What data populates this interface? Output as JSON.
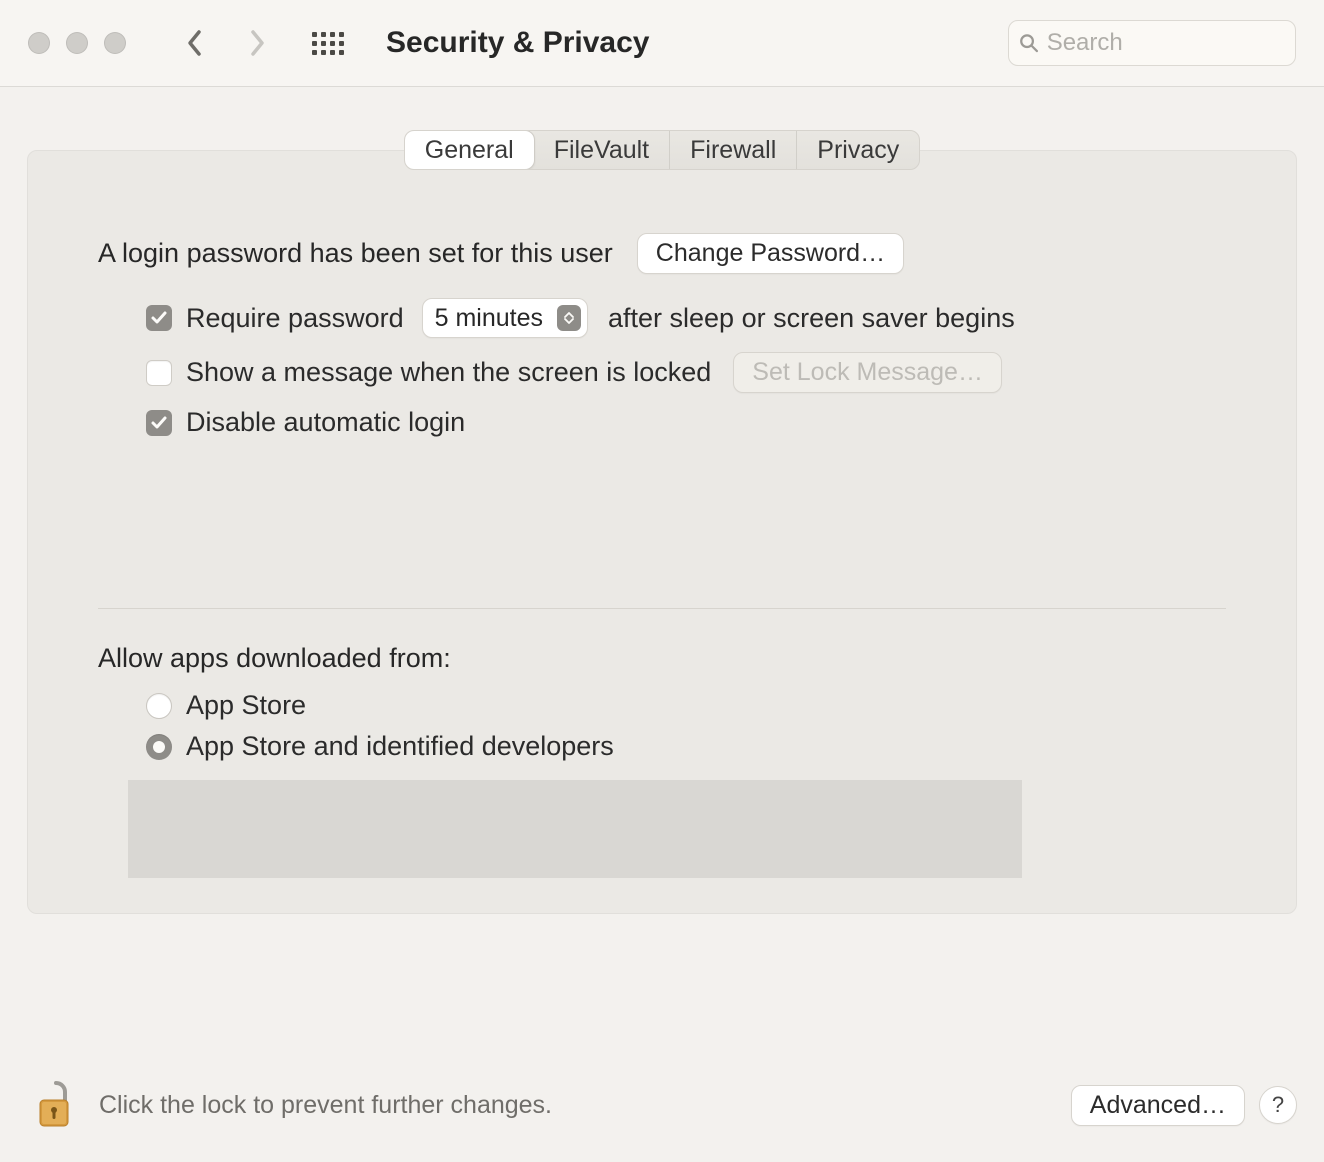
{
  "window": {
    "title": "Security & Privacy"
  },
  "search": {
    "placeholder": "Search"
  },
  "tabs": {
    "general": "General",
    "filevault": "FileVault",
    "firewall": "Firewall",
    "privacy": "Privacy"
  },
  "login": {
    "has_password_text": "A login password has been set for this user",
    "change_password_btn": "Change Password…",
    "require_password_label": "Require password",
    "require_password_delay": "5 minutes",
    "require_password_suffix": "after sleep or screen saver begins",
    "show_message_label": "Show a message when the screen is locked",
    "set_lock_message_btn": "Set Lock Message…",
    "disable_auto_login_label": "Disable automatic login"
  },
  "gatekeeper": {
    "heading": "Allow apps downloaded from:",
    "option_appstore": "App Store",
    "option_identified": "App Store and identified developers"
  },
  "footer": {
    "lock_text": "Click the lock to prevent further changes.",
    "advanced_btn": "Advanced…",
    "help": "?"
  }
}
